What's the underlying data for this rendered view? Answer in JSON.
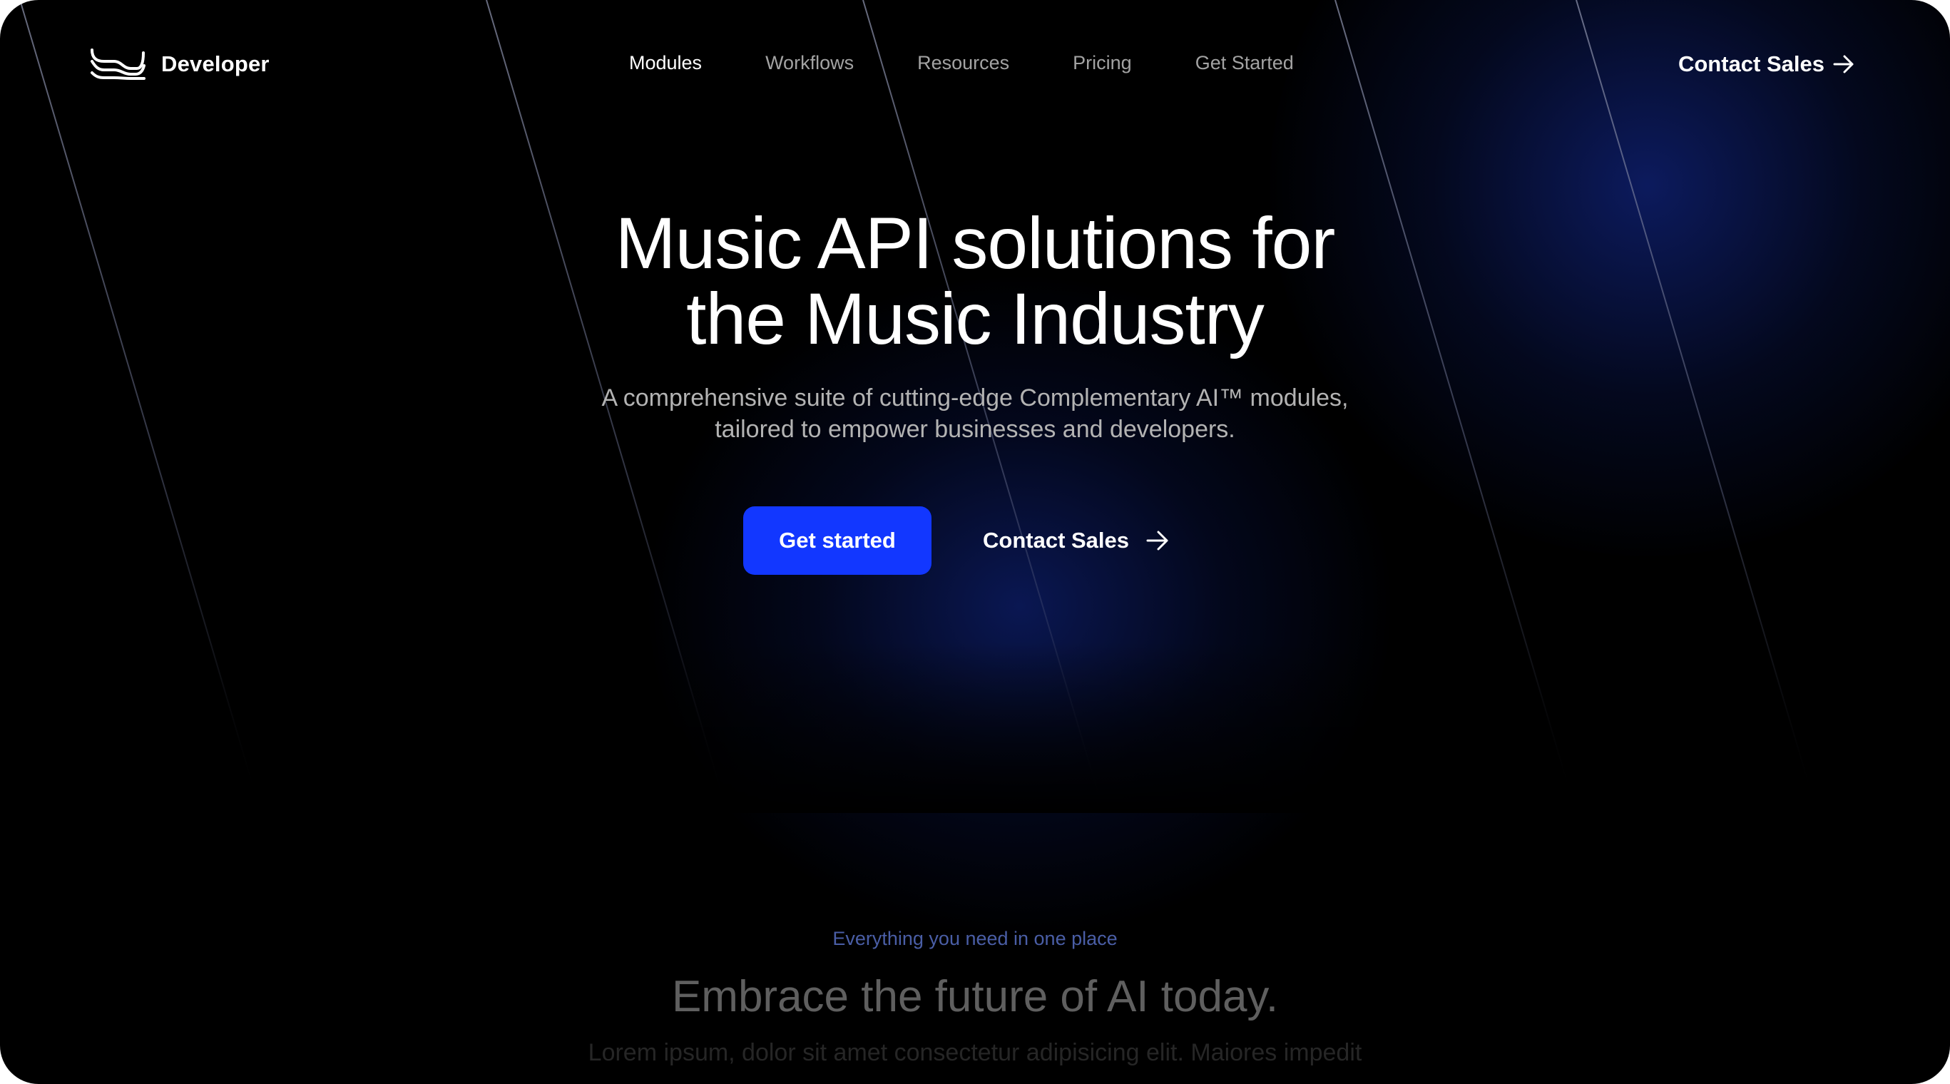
{
  "brand": {
    "name": "Developer",
    "logo_icon": "wave-logo-icon"
  },
  "nav": {
    "items": [
      {
        "label": "Modules",
        "active": true
      },
      {
        "label": "Workflows",
        "active": false
      },
      {
        "label": "Resources",
        "active": false
      },
      {
        "label": "Pricing",
        "active": false
      },
      {
        "label": "Get Started",
        "active": false
      }
    ]
  },
  "header": {
    "cta_label": "Contact Sales",
    "cta_icon": "arrow-right-icon"
  },
  "hero": {
    "title_line1": "Music API solutions for",
    "title_line2": "the Music Industry",
    "subtitle_line1": "A comprehensive suite of cutting-edge Complementary AI™ modules,",
    "subtitle_line2": "tailored to empower businesses and developers.",
    "primary_button": "Get started",
    "secondary_button": "Contact Sales",
    "secondary_icon": "arrow-right-icon"
  },
  "section": {
    "eyebrow": "Everything you need in one place",
    "title": "Embrace the future of AI today.",
    "text": "Lorem ipsum, dolor sit amet consectetur adipisicing elit. Maiores impedit"
  },
  "colors": {
    "background": "#000000",
    "accent": "#1237ff",
    "nav_inactive": "#a3a3a3",
    "eyebrow": "#4a5ea6"
  }
}
